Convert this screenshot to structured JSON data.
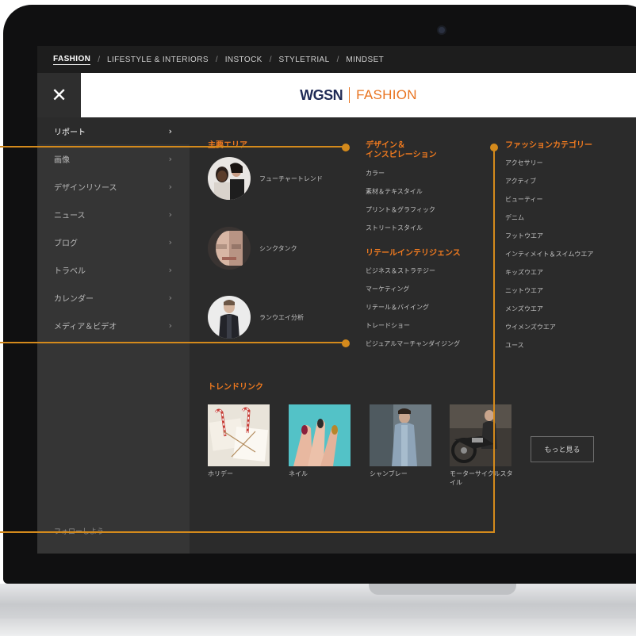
{
  "topnav": {
    "items": [
      "FASHION",
      "LIFESTYLE & INTERIORS",
      "INSTOCK",
      "STYLETRIAL",
      "MINDSET"
    ],
    "separator": "/"
  },
  "header": {
    "close_glyph": "✕",
    "brand_left": "WGSN",
    "brand_right": "FASHION"
  },
  "sidebar": {
    "items": [
      {
        "label": "リポート",
        "chevron": "›"
      },
      {
        "label": "画像",
        "chevron": "›"
      },
      {
        "label": "デザインリソース",
        "chevron": "›"
      },
      {
        "label": "ニュース",
        "chevron": "›"
      },
      {
        "label": "ブログ",
        "chevron": "›"
      },
      {
        "label": "トラベル",
        "chevron": "›"
      },
      {
        "label": "カレンダー",
        "chevron": "›"
      },
      {
        "label": "メディア＆ビデオ",
        "chevron": "›"
      }
    ],
    "follow": "フォローしよう"
  },
  "key_areas": {
    "heading": "主要エリア",
    "items": [
      {
        "label": "フューチャートレンド"
      },
      {
        "label": "シンクタンク"
      },
      {
        "label": "ランウエイ分析"
      }
    ]
  },
  "design": {
    "heading_line1": "デザイン＆",
    "heading_line2": "インスピレーション",
    "links": [
      "カラー",
      "素材＆テキスタイル",
      "プリント＆グラフィック",
      "ストリートスタイル"
    ]
  },
  "retail": {
    "heading": "リテールインテリジェンス",
    "links": [
      "ビジネス＆ストラテジー",
      "マーケティング",
      "リテール＆バイイング",
      "トレードショー",
      "ビジュアルマーチャンダイジング"
    ]
  },
  "categories": {
    "heading": "ファッションカテゴリー",
    "links": [
      "アクセサリー",
      "アクティブ",
      "ビューティー",
      "デニム",
      "フットウエア",
      "インティメイト＆スイムウエア",
      "キッズウエア",
      "ニットウエア",
      "メンズウエア",
      "ウイメンズウエア",
      "ユース"
    ]
  },
  "trend_links": {
    "heading": "トレンドリンク",
    "items": [
      {
        "label": "ホリデー"
      },
      {
        "label": "ネイル"
      },
      {
        "label": "シャンブレー"
      },
      {
        "label_line1": "モーターサイクルスタ",
        "label_line2": "イル"
      }
    ],
    "more_button": "もっと見る"
  },
  "colors": {
    "accent": "#f07a1f",
    "callout": "#d48a1c",
    "brand_navy": "#1f2a55",
    "screen_bg": "#2b2b2b",
    "sidebar_bg": "#353535"
  }
}
